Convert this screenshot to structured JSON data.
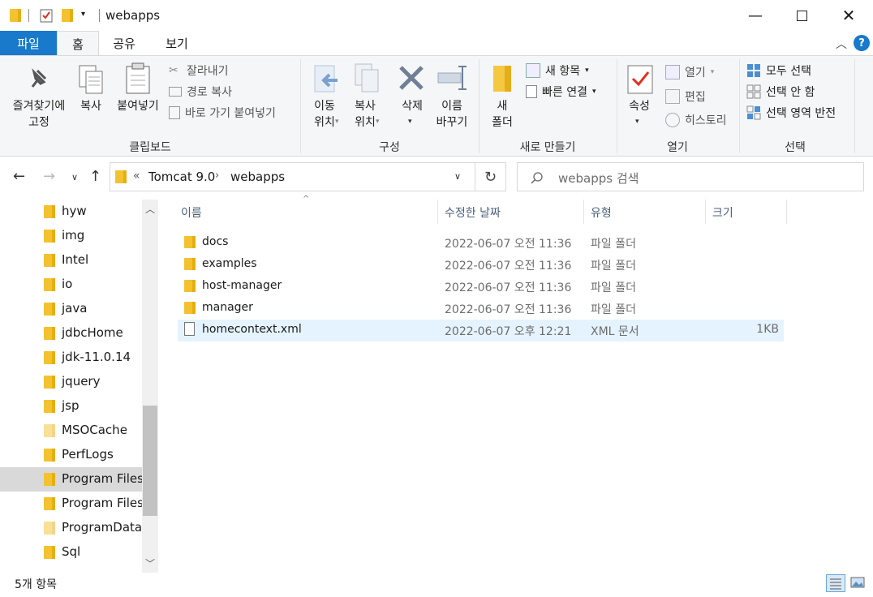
{
  "window": {
    "title": "webapps"
  },
  "tabs": {
    "file": "파일",
    "home": "홈",
    "share": "공유",
    "view": "보기"
  },
  "ribbon": {
    "clipboard": {
      "title": "클립보드",
      "pin_quick": "즐겨찾기에\n고정",
      "copy": "복사",
      "paste": "붙여넣기",
      "cut": "잘라내기",
      "copy_path": "경로 복사",
      "paste_shortcut": "바로 가기 붙여넣기"
    },
    "organize": {
      "title": "구성",
      "move_to": "이동\n위치",
      "copy_to": "복사\n위치",
      "delete": "삭제",
      "rename": "이름\n바꾸기"
    },
    "new": {
      "title": "새로 만들기",
      "new_folder": "새\n폴더",
      "new_item": "새 항목",
      "easy_access": "빠른 연결"
    },
    "open": {
      "title": "열기",
      "properties": "속성",
      "open": "열기",
      "edit": "편집",
      "history": "히스토리"
    },
    "select": {
      "title": "선택",
      "select_all": "모두 선택",
      "select_none": "선택 안 함",
      "invert": "선택 영역 반전"
    }
  },
  "address": {
    "overflow": "«",
    "crumbs": [
      "Tomcat 9.0",
      "webapps"
    ],
    "search_placeholder": "webapps 검색"
  },
  "nav": {
    "items": [
      {
        "label": "hyw"
      },
      {
        "label": "img"
      },
      {
        "label": "Intel"
      },
      {
        "label": "io"
      },
      {
        "label": "java"
      },
      {
        "label": "jdbcHome"
      },
      {
        "label": "jdk-11.0.14"
      },
      {
        "label": "jquery"
      },
      {
        "label": "jsp"
      },
      {
        "label": "MSOCache"
      },
      {
        "label": "PerfLogs"
      },
      {
        "label": "Program Files"
      },
      {
        "label": "Program Files ("
      },
      {
        "label": "ProgramData"
      },
      {
        "label": "Sql"
      }
    ],
    "selected_index": 11
  },
  "columns": {
    "name": "이름",
    "date": "수정한 날짜",
    "type": "유형",
    "size": "크기"
  },
  "files": [
    {
      "name": "docs",
      "date": "2022-06-07 오전 11:36",
      "type": "파일 폴더",
      "size": "",
      "kind": "folder"
    },
    {
      "name": "examples",
      "date": "2022-06-07 오전 11:36",
      "type": "파일 폴더",
      "size": "",
      "kind": "folder"
    },
    {
      "name": "host-manager",
      "date": "2022-06-07 오전 11:36",
      "type": "파일 폴더",
      "size": "",
      "kind": "folder"
    },
    {
      "name": "manager",
      "date": "2022-06-07 오전 11:36",
      "type": "파일 폴더",
      "size": "",
      "kind": "folder"
    },
    {
      "name": "homecontext.xml",
      "date": "2022-06-07 오후 12:21",
      "type": "XML 문서",
      "size": "1KB",
      "kind": "file"
    }
  ],
  "status": {
    "count": "5개 항목"
  },
  "colors": {
    "accent": "#1979ca",
    "folder": "#f2c230",
    "selection": "#e5f3ff"
  }
}
